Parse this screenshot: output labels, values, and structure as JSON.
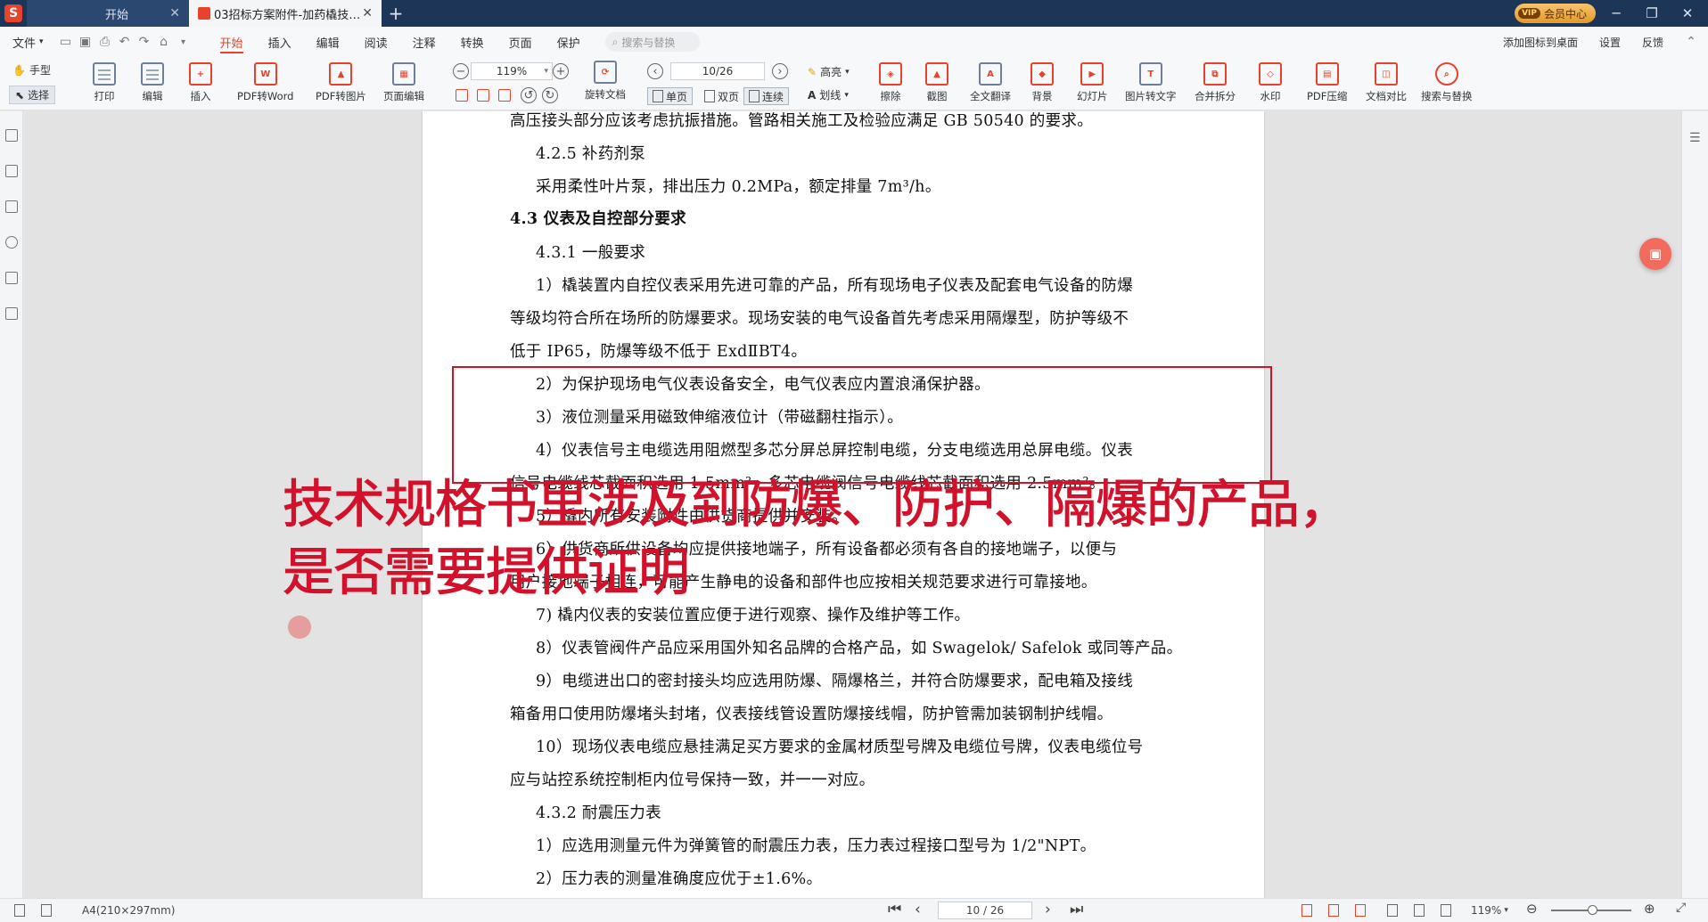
{
  "titlebar": {
    "tabs": [
      {
        "label": "开始"
      },
      {
        "label": "03招标方案附件-加药橇技术..."
      }
    ],
    "vip_label": "会员中心",
    "vip_badge": "VIP"
  },
  "menubar": {
    "file_label": "文件",
    "items": [
      "开始",
      "插入",
      "编辑",
      "阅读",
      "注释",
      "转换",
      "页面",
      "保护"
    ],
    "search_placeholder": "搜索与替换",
    "right_items": [
      "添加图标到桌面",
      "设置",
      "反馈"
    ]
  },
  "ribbon": {
    "hand_tool": "手型",
    "select_tool": "选择",
    "buttons": [
      "打印",
      "编辑",
      "插入",
      "PDF转Word",
      "PDF转图片",
      "页面编辑"
    ],
    "zoom_value": "119%",
    "page_value": "10/26",
    "rotate_label": "旋转文档",
    "single_page": "单页",
    "double_page": "双页",
    "continuous": "连续",
    "highlight": "高亮",
    "underline": "划线",
    "buttons2": [
      "擦除",
      "截图",
      "全文翻译",
      "背景",
      "幻灯片",
      "图片转文字",
      "合并拆分",
      "水印",
      "PDF压缩",
      "文档对比",
      "搜索与替换"
    ]
  },
  "document": {
    "lines": [
      "高压接头部分应该考虑抗振措施。管路相关施工及检验应满足 GB 50540 的要求。",
      "4.2.5 补药剂泵",
      "采用柔性叶片泵，排出压力 0.2MPa，额定排量 7m³/h。",
      "4.3 仪表及自控部分要求",
      "4.3.1  一般要求",
      "1）橇装置内自控仪表采用先进可靠的产品，所有现场电子仪表及配套电气设备的防爆",
      "等级均符合所在场所的防爆要求。现场安装的电气设备首先考虑采用隔爆型，防护等级不",
      "低于 IP65，防爆等级不低于 ExdⅡBT4。",
      "2）为保护现场电气仪表设备安全，电气仪表应内置浪涌保护器。",
      "3）液位测量采用磁致伸缩液位计（带磁翻柱指示）。",
      "4）仪表信号主电缆选用阻燃型多芯分屏总屏控制电缆，分支电缆选用总屏电缆。仪表",
      "信号电缆线芯截面积选用 1.5mm²，多芯电缆阀信号电缆线芯截面积选用 2.5mm²。",
      "5）橇内所有安装附件由供货商提供并安装。",
      "6）供货商所供设备均应提供接地端子，所有设备都必须有各自的接地端子，以便与",
      "用户接地端子相连，可能产生静电的设备和部件也应按相关规范要求进行可靠接地。",
      "7) 橇内仪表的安装位置应便于进行观察、操作及维护等工作。",
      "8）仪表管阀件产品应采用国外知名品牌的合格产品，如 Swagelok/ Safelok 或同等产品。",
      "9）电缆进出口的密封接头均应选用防爆、隔爆格兰，并符合防爆要求，配电箱及接线",
      "箱备用口使用防爆堵头封堵，仪表接线管设置防爆接线帽，防护管需加装钢制护线帽。",
      "10）现场仪表电缆应悬挂满足买方要求的金属材质型号牌及电缆位号牌，仪表电缆位号",
      "应与站控系统控制柜内位号保持一致，并一一对应。",
      "4.3.2  耐震压力表",
      "1）应选用测量元件为弹簧管的耐震压力表，压力表过程接口型号为 1/2\"NPT。",
      "2）压力表的测量准确度应优于±1.6%。"
    ],
    "overlay_line1": "技术规格书里涉及到防爆、防护、隔爆的产品，",
    "overlay_line2": "是否需要提供证明"
  },
  "statusbar": {
    "paper_size": "A4(210×297mm)",
    "page_indicator": "10 / 26",
    "zoom": "119%"
  },
  "colors": {
    "accent": "#e8412c",
    "annotation_red": "#d1122a",
    "titlebar": "#1d3557"
  }
}
